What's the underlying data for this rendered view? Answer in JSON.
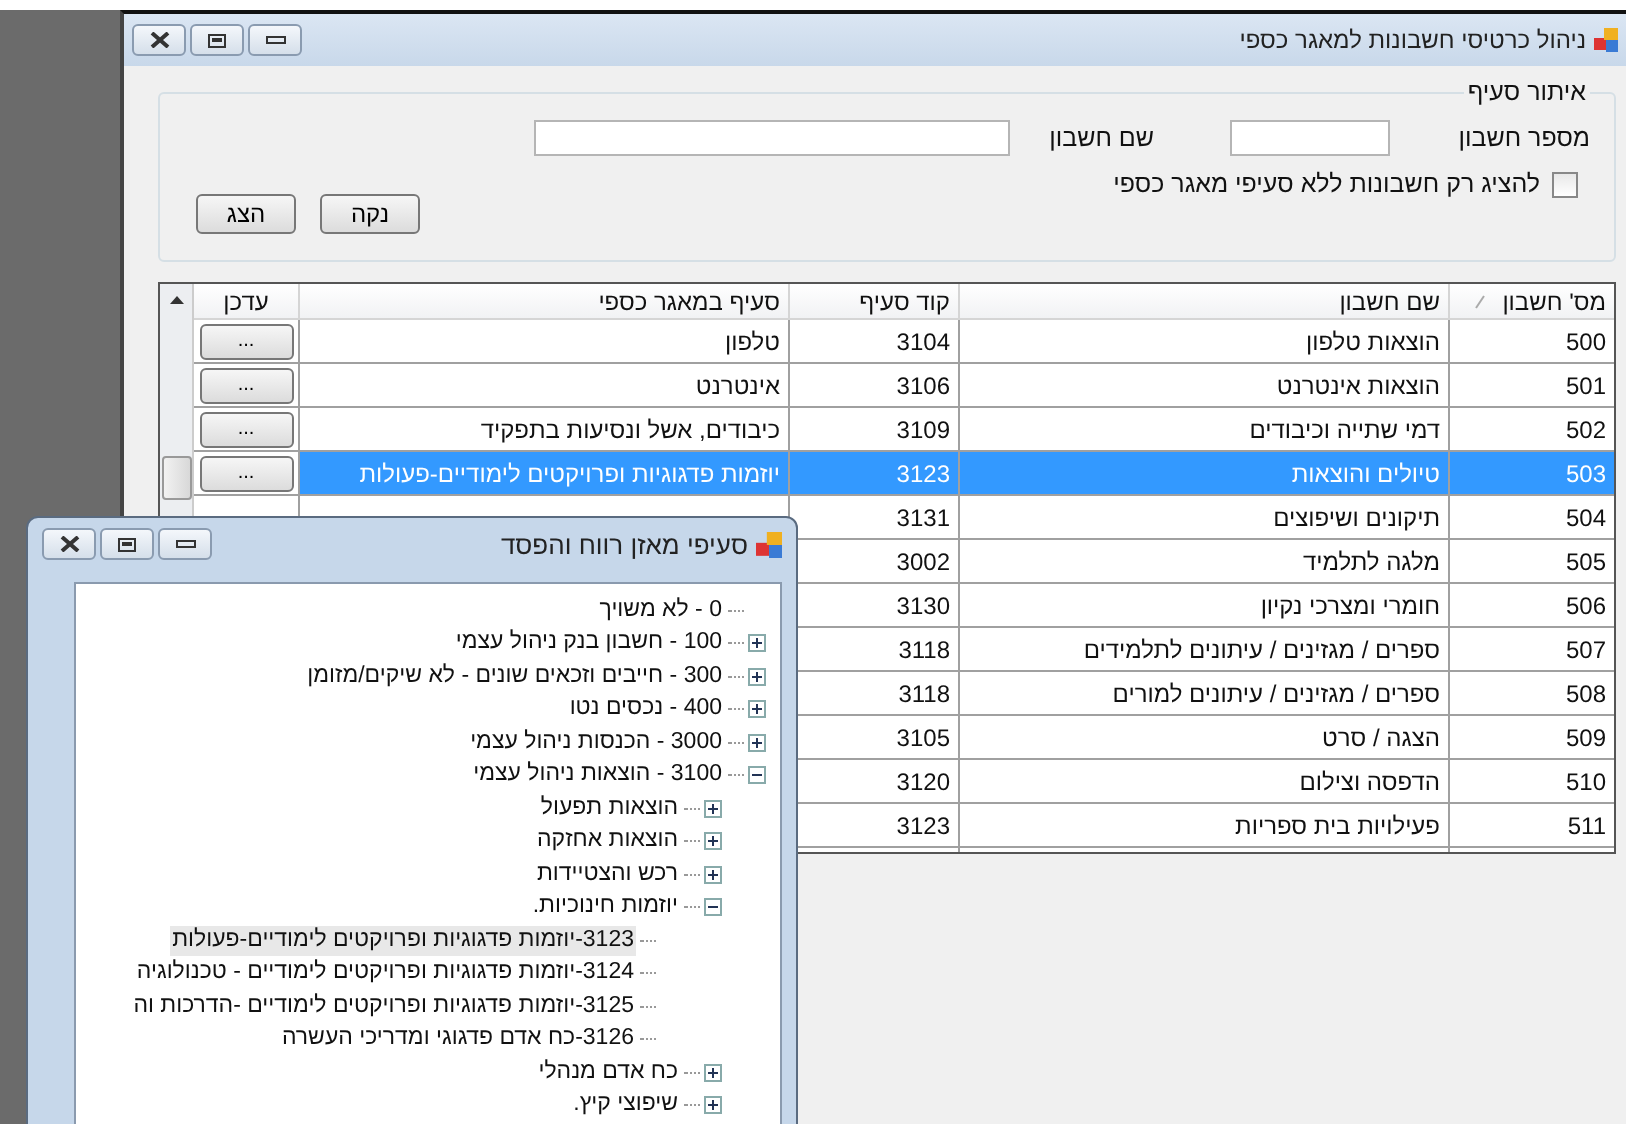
{
  "main_window": {
    "title": "ניהול כרטיסי חשבונות למאגר כספי",
    "search_group": {
      "title": "איתור סעיף",
      "fields": [
        {
          "label": "מספר חשבון"
        },
        {
          "label": "שם חשבון"
        }
      ],
      "checkbox": {
        "label": "להציג רק חשבונות ללא סעיפי מאגר כספי",
        "checked": false
      },
      "buttons": [
        "נקה",
        "הצג"
      ]
    },
    "grid": {
      "columns": [
        "מס' חשבון",
        "שם חשבון",
        "קוד סעיף",
        "סעיף במאגר כספי",
        "עדכן"
      ],
      "rows": [
        {
          "account_no": "500",
          "account_name": "הוצאות טלפון",
          "code": "3104",
          "sub": "טלפון",
          "update": "...",
          "selected": false
        },
        {
          "account_no": "501",
          "account_name": "הוצאות אינטרנט",
          "code": "3106",
          "sub": "אינטרנט",
          "update": "...",
          "selected": false
        },
        {
          "account_no": "502",
          "account_name": "דמי שתייה וכיבודים",
          "code": "3109",
          "sub": "כיבודים, אשל ונסיעות בתפקיד",
          "update": "...",
          "selected": false
        },
        {
          "account_no": "503",
          "account_name": "טיולים והוצאות",
          "code": "3123",
          "sub": "יוזמות פדגוגיות ופרויקטים לימודיים-פעולות",
          "update": "...",
          "selected": true
        },
        {
          "account_no": "504",
          "account_name": "תיקונים ושיפוצים",
          "code": "3131",
          "selected": false
        },
        {
          "account_no": "505",
          "account_name": "מלגה לתלמיד",
          "code": "3002",
          "selected": false
        },
        {
          "account_no": "506",
          "account_name": "חומרי ומצרכי נקיון",
          "code": "3130",
          "selected": false
        },
        {
          "account_no": "507",
          "account_name": "ספרים / מגזינים / עיתונים לתלמידים",
          "code": "3118",
          "selected": false
        },
        {
          "account_no": "508",
          "account_name": "ספרים / מגזינים / עיתונים למורים",
          "code": "3118",
          "selected": false
        },
        {
          "account_no": "509",
          "account_name": "הצגה / סרט",
          "code": "3105",
          "selected": false
        },
        {
          "account_no": "510",
          "account_name": "הדפסה וצילום",
          "code": "3120",
          "selected": false
        },
        {
          "account_no": "511",
          "account_name": "פעילויות בית ספריות",
          "code": "3123",
          "selected": false
        }
      ]
    }
  },
  "dialog": {
    "title": "סעיפי מאזן רווח והפסד",
    "tree": [
      {
        "label": "0 - לא משויך",
        "selected": false
      },
      {
        "label": "100 - חשבון בנק ניהול עצמי",
        "expanded": false,
        "selected": false
      },
      {
        "label": "300 - חייבים וזכאים שונים - לא שיקים/מזומן",
        "expanded": false,
        "selected": false
      },
      {
        "label": "400 - נכסים נטו",
        "expanded": false,
        "selected": false
      },
      {
        "label": "3000 - הכנסות ניהול עצמי",
        "expanded": false,
        "selected": false
      },
      {
        "label": "3100 - הוצאות ניהול עצמי",
        "expanded": true,
        "selected": false,
        "children": [
          {
            "label": "הוצאות תפעול",
            "expanded": false,
            "selected": false
          },
          {
            "label": "הוצאות אחזקה",
            "expanded": false,
            "selected": false
          },
          {
            "label": "רכש והצטיידות",
            "expanded": false,
            "selected": false
          },
          {
            "label": "יוזמות חינוכיות.",
            "expanded": true,
            "selected": false,
            "children": [
              {
                "label": "3123-יוזמות פדגוגיות ופרויקטים לימודיים-פעולות",
                "selected": true
              },
              {
                "label": "3124-יוזמות פדגוגיות ופרויקטים לימודיים - טכנולוגיה",
                "selected": false
              },
              {
                "label": "3125-יוזמות פדגוגיות ופרויקטים לימודיים -הדרכות וה",
                "selected": false
              },
              {
                "label": "3126-כח אדם פדגוגי ומדריכי העשרה",
                "selected": false
              }
            ]
          },
          {
            "label": "כח אדם מנהלי",
            "expanded": false,
            "selected": false
          },
          {
            "label": "שיפוצי קיץ.",
            "expanded": false,
            "selected": false
          }
        ]
      }
    ]
  }
}
